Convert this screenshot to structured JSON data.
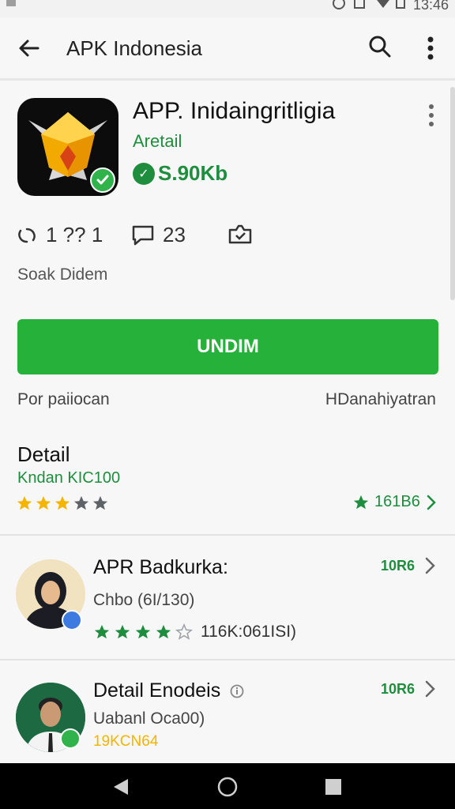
{
  "status": {
    "time": "13:46"
  },
  "app_bar": {
    "title": "APK Indonesia"
  },
  "app": {
    "name": "APP. Inidaingritligia",
    "category": "Aretail",
    "size": "S.90Kb",
    "verified_color": "#2fb34a"
  },
  "stats": {
    "installs": "1 ?? 1",
    "reviews": "23",
    "caption": "Soak Didem"
  },
  "install_button": {
    "label": "UNDIM",
    "color": "#25b13a"
  },
  "sub_row": {
    "left": "Por paiiocan",
    "right": "HDanahiyatran"
  },
  "detail": {
    "title": "Detail",
    "subtitle": "Kndan KIC100",
    "rating_label": "161B6",
    "stars": 3
  },
  "reviews": [
    {
      "name": "APR Badkurka:",
      "sub": "Chbo (6I/130)",
      "meta": "10R6",
      "stars": 4,
      "score": "116K:061ISI)"
    },
    {
      "name": "Detail Enodeis",
      "sub": "Uabanl Oca00)",
      "meta": "10R6",
      "note": "19KCN64"
    }
  ],
  "colors": {
    "accent_green": "#1e8e3e",
    "button_green": "#25b13a",
    "star_gold": "#f5b400"
  }
}
